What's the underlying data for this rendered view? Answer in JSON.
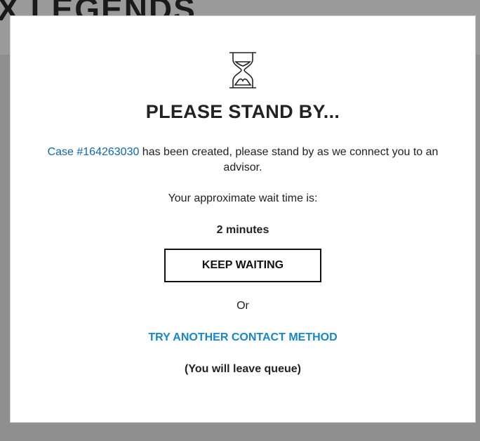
{
  "background": {
    "site_title": "X LEGENDS"
  },
  "modal": {
    "icon": "hourglass-icon",
    "title": "PLEASE STAND BY...",
    "case_link_text": "Case #164263030",
    "case_message": " has been created, please stand by as we connect you to an advisor.",
    "wait_label": "Your approximate wait time is:",
    "wait_value": "2 minutes",
    "keep_waiting_label": "KEEP WAITING",
    "or_text": "Or",
    "try_another_label": "TRY ANOTHER CONTACT METHOD",
    "leave_note": "(You will leave queue)"
  },
  "colors": {
    "overlay": "#8f8f8f",
    "link_blue": "#0f67b2",
    "action_blue": "#1787c8",
    "text_dark": "#222222"
  }
}
